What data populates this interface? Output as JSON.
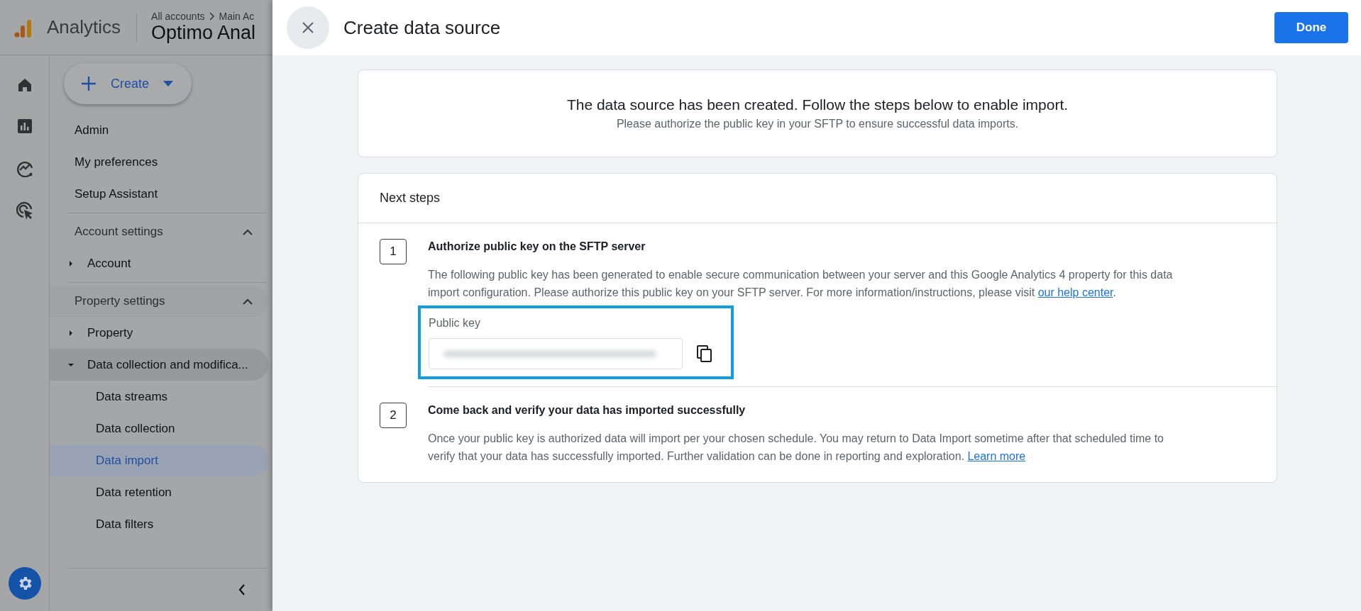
{
  "app_bar": {
    "product": "Analytics",
    "breadcrumb": [
      "All accounts",
      "Main Ac"
    ],
    "property": "Optimo Anal"
  },
  "create_button": {
    "label": "Create"
  },
  "nav": [
    {
      "label": "Admin"
    },
    {
      "label": "My preferences"
    },
    {
      "label": "Setup Assistant"
    }
  ],
  "sections": [
    {
      "title": "Account settings",
      "expanded": true,
      "items": [
        {
          "label": "Account",
          "expanded": false
        }
      ]
    },
    {
      "title": "Property settings",
      "expanded": true,
      "items": [
        {
          "label": "Property",
          "expanded": false
        },
        {
          "label": "Data collection and modifica...",
          "expanded": true,
          "children": [
            {
              "label": "Data streams",
              "selected": false
            },
            {
              "label": "Data collection",
              "selected": false
            },
            {
              "label": "Data import",
              "selected": true
            },
            {
              "label": "Data retention",
              "selected": false
            },
            {
              "label": "Data filters",
              "selected": false
            }
          ]
        }
      ]
    }
  ],
  "dialog": {
    "title": "Create data source",
    "done_button": "Done",
    "summary": {
      "heading": "The data source has been created. Follow the steps below to enable import.",
      "subtext": "Please authorize the public key in your SFTP to ensure successful data imports."
    },
    "steps_card": {
      "title": "Next steps",
      "steps": [
        {
          "number": "1",
          "title": "Authorize public key on the SFTP server",
          "text": "The following public key has been generated to enable secure communication between your server and this Google Analytics 4 property for this data import configuration. Please authorize this public key on your SFTP server. For more information/instructions, please visit ",
          "link": "our help center",
          "text_after": ".",
          "field": {
            "label": "Public key",
            "highlighted": true
          }
        },
        {
          "number": "2",
          "title": "Come back and verify your data has imported successfully",
          "text": "Once your public key is authorized data will import per your chosen schedule. You may return to Data Import sometime after that scheduled time to verify that your data has successfully imported. Further validation can be done in reporting and exploration. ",
          "link": "Learn more"
        }
      ]
    }
  }
}
